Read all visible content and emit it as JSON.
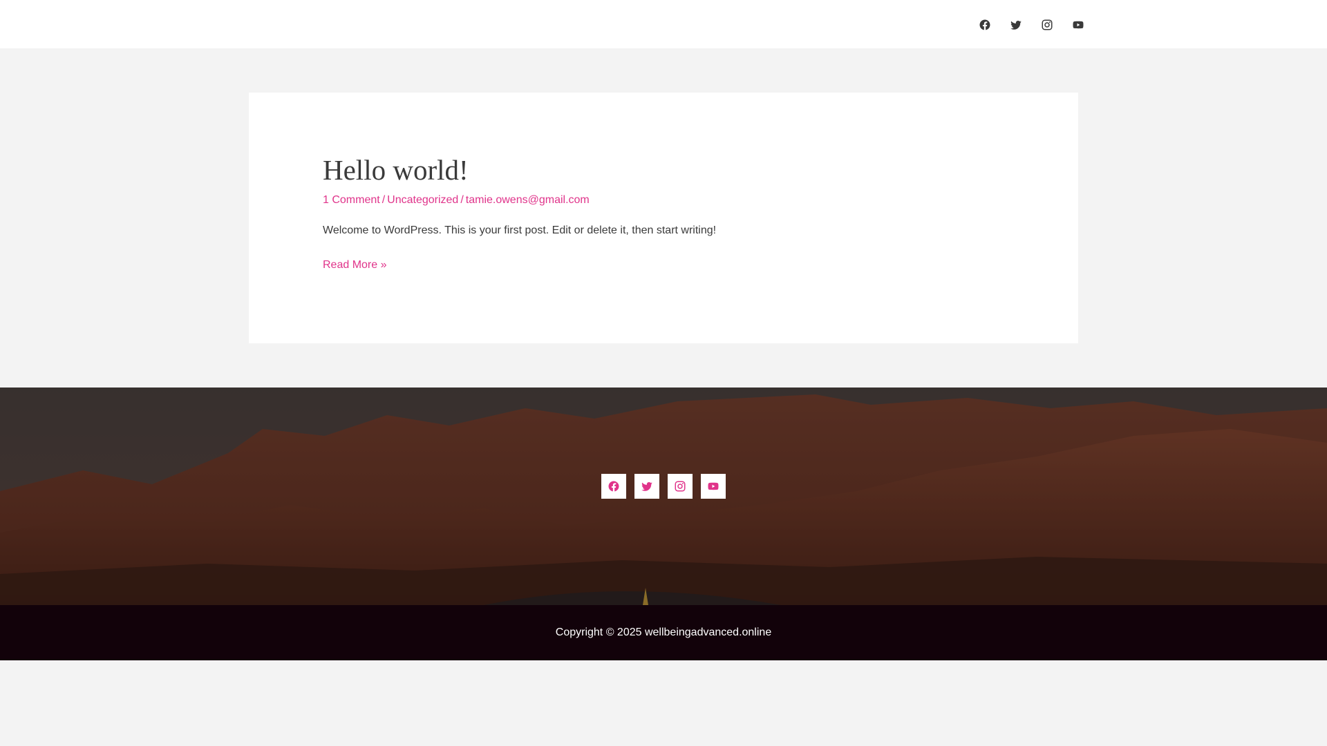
{
  "colors": {
    "accent": "#e0338a",
    "text": "#3a3a3a",
    "page_bg": "#f3f3f3",
    "card_bg": "#ffffff",
    "copyright_bg": "#12020a"
  },
  "header": {
    "social": [
      {
        "icon": "facebook-icon"
      },
      {
        "icon": "twitter-icon"
      },
      {
        "icon": "instagram-icon"
      },
      {
        "icon": "youtube-icon"
      }
    ]
  },
  "post": {
    "title": "Hello world!",
    "meta": {
      "comments": "1 Comment",
      "category": "Uncategorized",
      "author": "tamie.owens@gmail.com",
      "separator": "/"
    },
    "excerpt": "Welcome to WordPress. This is your first post. Edit or delete it, then start writing!",
    "read_more": "Read More »"
  },
  "footer": {
    "social": [
      {
        "icon": "facebook-icon"
      },
      {
        "icon": "twitter-icon"
      },
      {
        "icon": "instagram-icon"
      },
      {
        "icon": "youtube-icon"
      }
    ],
    "copyright": "Copyright © 2025 wellbeingadvanced.online"
  }
}
